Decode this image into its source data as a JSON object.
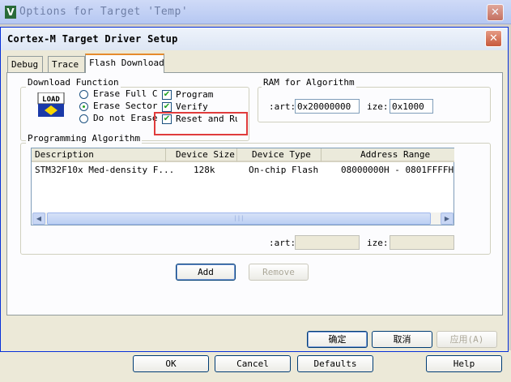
{
  "outer_window": {
    "title": "Options for Target 'Temp'",
    "logo_glyph": "V",
    "close_glyph": "✕",
    "buttons": {
      "ok": "OK",
      "cancel": "Cancel",
      "defaults": "Defaults",
      "help": "Help"
    }
  },
  "dialog": {
    "title": "Cortex-M Target Driver Setup",
    "close_glyph": "✕",
    "tabs": [
      {
        "label": "Debug"
      },
      {
        "label": "Trace"
      },
      {
        "label": "Flash Download"
      }
    ],
    "download_function": {
      "label": "Download Function",
      "icon_text": "LOAD",
      "erase_options": [
        {
          "label": "Erase Full C",
          "selected": false
        },
        {
          "label": "Erase Sector",
          "selected": true
        },
        {
          "label": "Do not Erase",
          "selected": false
        }
      ],
      "checks": [
        {
          "label": "Program",
          "checked": true
        },
        {
          "label": "Verify",
          "checked": true
        },
        {
          "label": "Reset and Run",
          "checked": true
        }
      ],
      "check_glyph": "✔"
    },
    "ram_for_algorithm": {
      "label": "RAM for Algorithm",
      "start_label": ":art:",
      "start_value": "0x20000000",
      "size_label": "ize:",
      "size_value": "0x1000"
    },
    "programming_algorithm": {
      "label": "Programming Algorithm",
      "columns": [
        "Description",
        "Device Size",
        "Device Type",
        "Address Range"
      ],
      "rows": [
        {
          "description": "STM32F10x Med-density F...",
          "size": "128k",
          "type": "On-chip Flash",
          "range": "08000000H - 0801FFFFH"
        }
      ],
      "start_label": ":art:",
      "size_label": "ize:",
      "add_label": "Add",
      "remove_label": "Remove",
      "scroll_left": "◀",
      "scroll_right": "▶",
      "scroll_grip": "|||"
    },
    "buttons": {
      "ok": "确定",
      "cancel": "取消",
      "apply": "应用(A)"
    }
  }
}
